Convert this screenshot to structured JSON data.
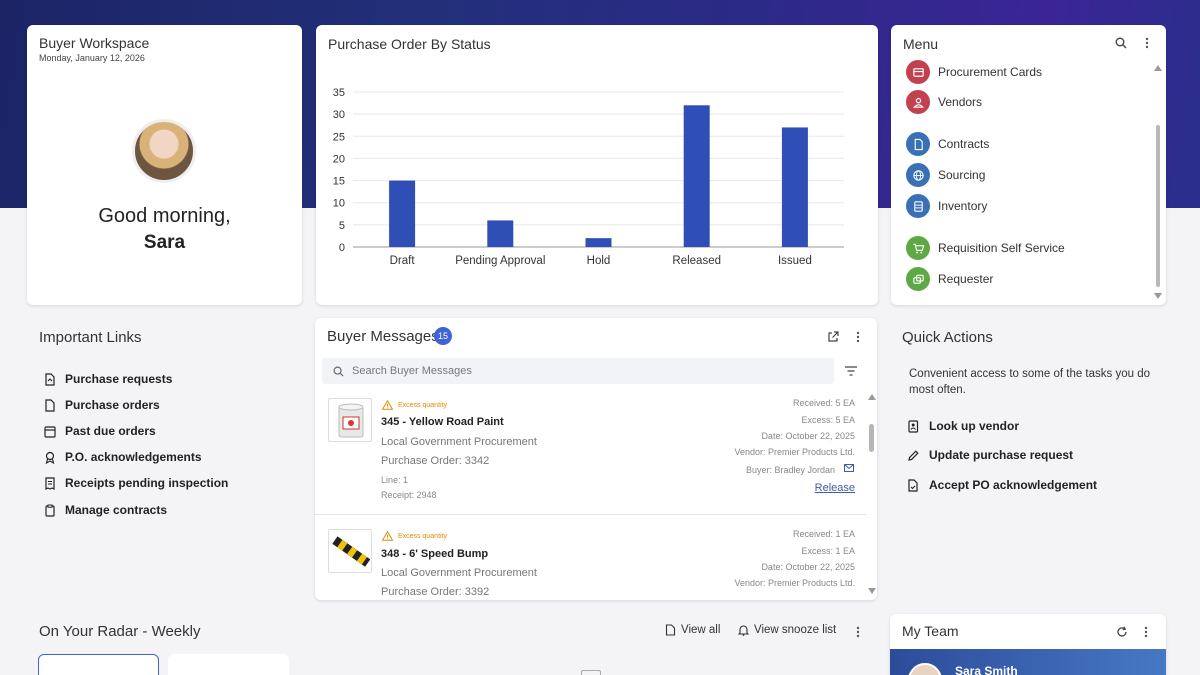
{
  "workspace": {
    "title": "Buyer Workspace",
    "date": "Monday, January 12, 2026",
    "greeting_line1": "Good morning,",
    "greeting_name": "Sara"
  },
  "chart_card": {
    "title": "Purchase Order By Status"
  },
  "chart_data": {
    "type": "bar",
    "title": "Purchase Order By Status",
    "categories": [
      "Draft",
      "Pending Approval",
      "Hold",
      "Released",
      "Issued"
    ],
    "values": [
      15,
      6,
      2,
      32,
      27
    ],
    "ylim": [
      0,
      35
    ],
    "yticks": [
      0,
      5,
      10,
      15,
      20,
      25,
      30,
      35
    ],
    "grid": true,
    "color": "#2f4fb7"
  },
  "menu": {
    "title": "Menu",
    "items": [
      {
        "label": "Procurement Cards",
        "icon": "card-icon",
        "color": "#c2414f"
      },
      {
        "label": "Vendors",
        "icon": "person-icon",
        "color": "#c2414f"
      },
      {
        "label": "Contracts",
        "icon": "document-icon",
        "color": "#3a70b5"
      },
      {
        "label": "Sourcing",
        "icon": "globe-icon",
        "color": "#3a70b5"
      },
      {
        "label": "Inventory",
        "icon": "inventory-icon",
        "color": "#3a70b5"
      },
      {
        "label": "Requisition Self Service",
        "icon": "cart-icon",
        "color": "#5ea845"
      },
      {
        "label": "Requester",
        "icon": "stack-icon",
        "color": "#5ea845"
      }
    ]
  },
  "important_links": {
    "title": "Important Links",
    "items": [
      {
        "label": "Purchase requests"
      },
      {
        "label": "Purchase orders"
      },
      {
        "label": "Past due orders"
      },
      {
        "label": "P.O. acknowledgements"
      },
      {
        "label": "Receipts pending inspection"
      },
      {
        "label": "Manage contracts"
      }
    ]
  },
  "messages": {
    "title": "Buyer Messages",
    "count": "15",
    "search_placeholder": "Search Buyer Messages",
    "items": [
      {
        "warning": "Excess quantity",
        "title": "345 - Yellow Road Paint",
        "org": "Local Government Procurement",
        "po": "Purchase Order: 3342",
        "line": "Line: 1",
        "receipt": "Receipt: 2948",
        "received": "Received: 5 EA",
        "excess": "Excess: 5 EA",
        "date": "Date: October 22, 2025",
        "vendor": "Vendor: Premier Products Ltd.",
        "buyer": "Buyer: Bradley Jordan",
        "action": "Release"
      },
      {
        "warning": "Excess quantity",
        "title": "348 - 6' Speed Bump",
        "org": "Local Government Procurement",
        "po": "Purchase Order: 3392",
        "received": "Received: 1 EA",
        "excess": "Excess: 1 EA",
        "date": "Date: October 22, 2025",
        "vendor": "Vendor: Premier Products Ltd."
      }
    ]
  },
  "quick_actions": {
    "title": "Quick Actions",
    "description": "Convenient access to some of the tasks you do most often.",
    "items": [
      {
        "label": "Look up vendor"
      },
      {
        "label": "Update purchase request"
      },
      {
        "label": "Accept PO acknowledgement"
      }
    ]
  },
  "radar": {
    "title": "On Your Radar - Weekly",
    "view_all": "View all",
    "view_snooze": "View snooze list"
  },
  "team": {
    "title": "My Team",
    "member": "Sara Smith"
  }
}
